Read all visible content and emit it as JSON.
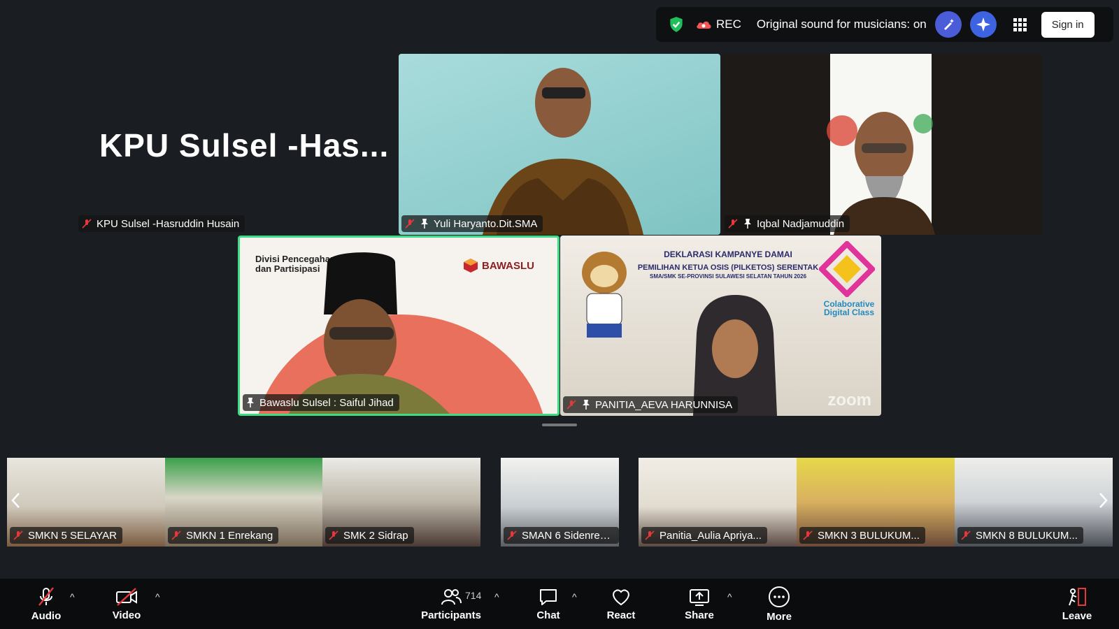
{
  "topbar": {
    "rec_label": "REC",
    "sound_status": "Original sound for musicians: on",
    "sign_in_label": "Sign in"
  },
  "main_tiles": {
    "kpu": {
      "display_text": "KPU  Sulsel  -Has...",
      "name": "KPU Sulsel -Hasruddin Husain"
    },
    "yuli": {
      "name": "Yuli Haryanto.Dit.SMA"
    },
    "iqbal": {
      "name": "Iqbal Nadjamuddin"
    },
    "bawaslu": {
      "name": "Bawaslu Sulsel : Saiful Jihad",
      "slide_title": "Divisi Pencegahan\ndan Partisipasi",
      "logo_text": "BAWASLU"
    },
    "panitia": {
      "name": "PANITIA_AEVA HARUNNISA",
      "banner_title": "DEKLARASI KAMPANYE DAMAI",
      "banner_sub": "PEMILIHAN KETUA OSIS (PILKETOS) SERENTAK",
      "banner_sub2": "SMA/SMK SE-PROVINSI SULAWESI SELATAN TAHUN 2026",
      "class_label": "Colaborative Digital Class",
      "watermark": "zoom"
    }
  },
  "strip": [
    {
      "name": "SMKN 5 SELAYAR"
    },
    {
      "name": "SMKN 1 Enrekang"
    },
    {
      "name": "SMK 2 Sidrap"
    },
    {
      "name": "SMAN 6 Sidenreng ..."
    },
    {
      "name": "Panitia_Aulia Apriya..."
    },
    {
      "name": "SMKN 3 BULUKUM..."
    },
    {
      "name": "SMKN 8 BULUKUM..."
    }
  ],
  "toolbar": {
    "audio": "Audio",
    "video": "Video",
    "participants": "Participants",
    "participants_count": "714",
    "chat": "Chat",
    "react": "React",
    "share": "Share",
    "more": "More",
    "leave": "Leave"
  },
  "colors": {
    "active_speaker_border": "#3ddc84",
    "shield_green": "#1fbf5c",
    "mute_red": "#e5383b"
  }
}
